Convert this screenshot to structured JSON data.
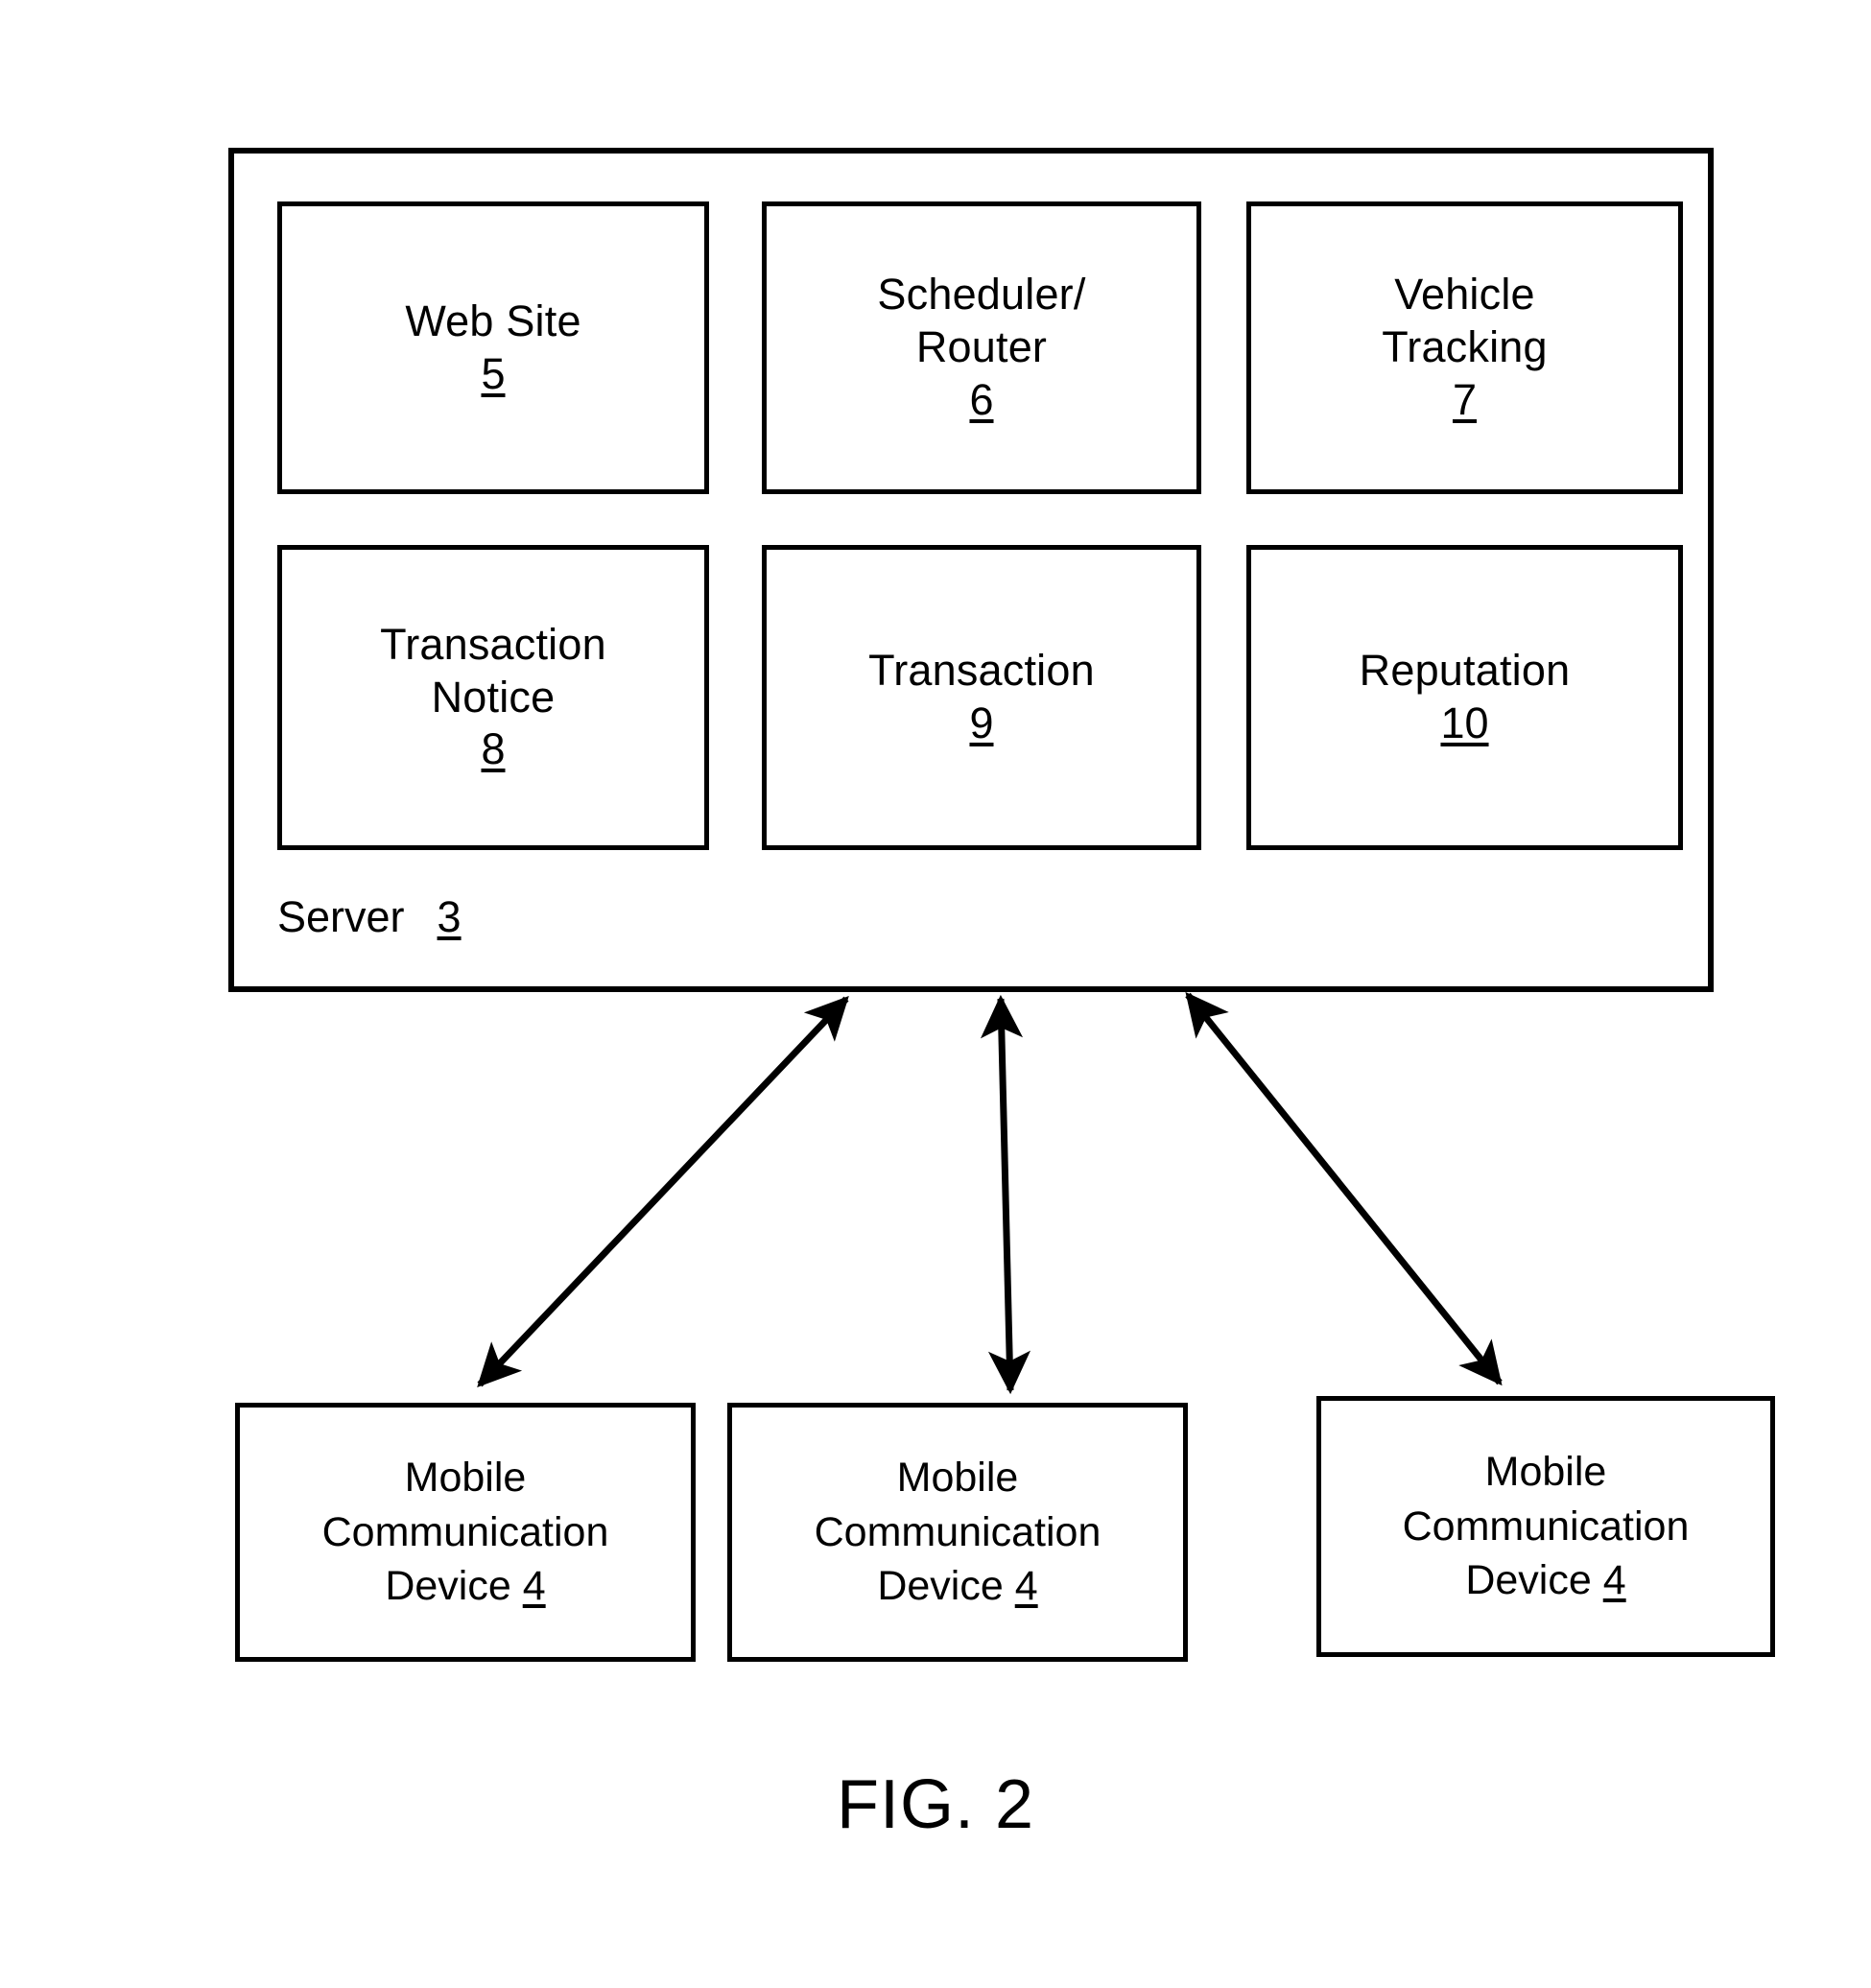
{
  "figure": {
    "caption": "FIG. 2",
    "type": "patent-block-diagram"
  },
  "server": {
    "label": "Server",
    "ref": "3",
    "modules": [
      {
        "name": "Web Site",
        "label": "Web Site",
        "ref": "5"
      },
      {
        "name": "Scheduler/Router",
        "label": "Scheduler/\nRouter",
        "ref": "6"
      },
      {
        "name": "Vehicle Tracking",
        "label": "Vehicle\nTracking",
        "ref": "7"
      },
      {
        "name": "Transaction Notice",
        "label": "Transaction\nNotice",
        "ref": "8"
      },
      {
        "name": "Transaction",
        "label": "Transaction",
        "ref": "9"
      },
      {
        "name": "Reputation",
        "label": "Reputation",
        "ref": "10"
      }
    ]
  },
  "devices": [
    {
      "line1": "Mobile",
      "line2": "Communication",
      "line3": "Device ",
      "ref": "4"
    },
    {
      "line1": "Mobile",
      "line2": "Communication",
      "line3": "Device ",
      "ref": "4"
    },
    {
      "line1": "Mobile",
      "line2": "Communication",
      "line3": "Device ",
      "ref": "4"
    }
  ],
  "connectors": [
    {
      "name": "server-to-device-1",
      "style": "double-headed-arrow",
      "direction": "diagonal-down-left"
    },
    {
      "name": "server-to-device-2",
      "style": "double-headed-arrow",
      "direction": "vertical"
    },
    {
      "name": "server-to-device-3",
      "style": "double-headed-arrow",
      "direction": "diagonal-down-right"
    }
  ],
  "colors": {
    "stroke": "#000000",
    "background": "#ffffff"
  }
}
